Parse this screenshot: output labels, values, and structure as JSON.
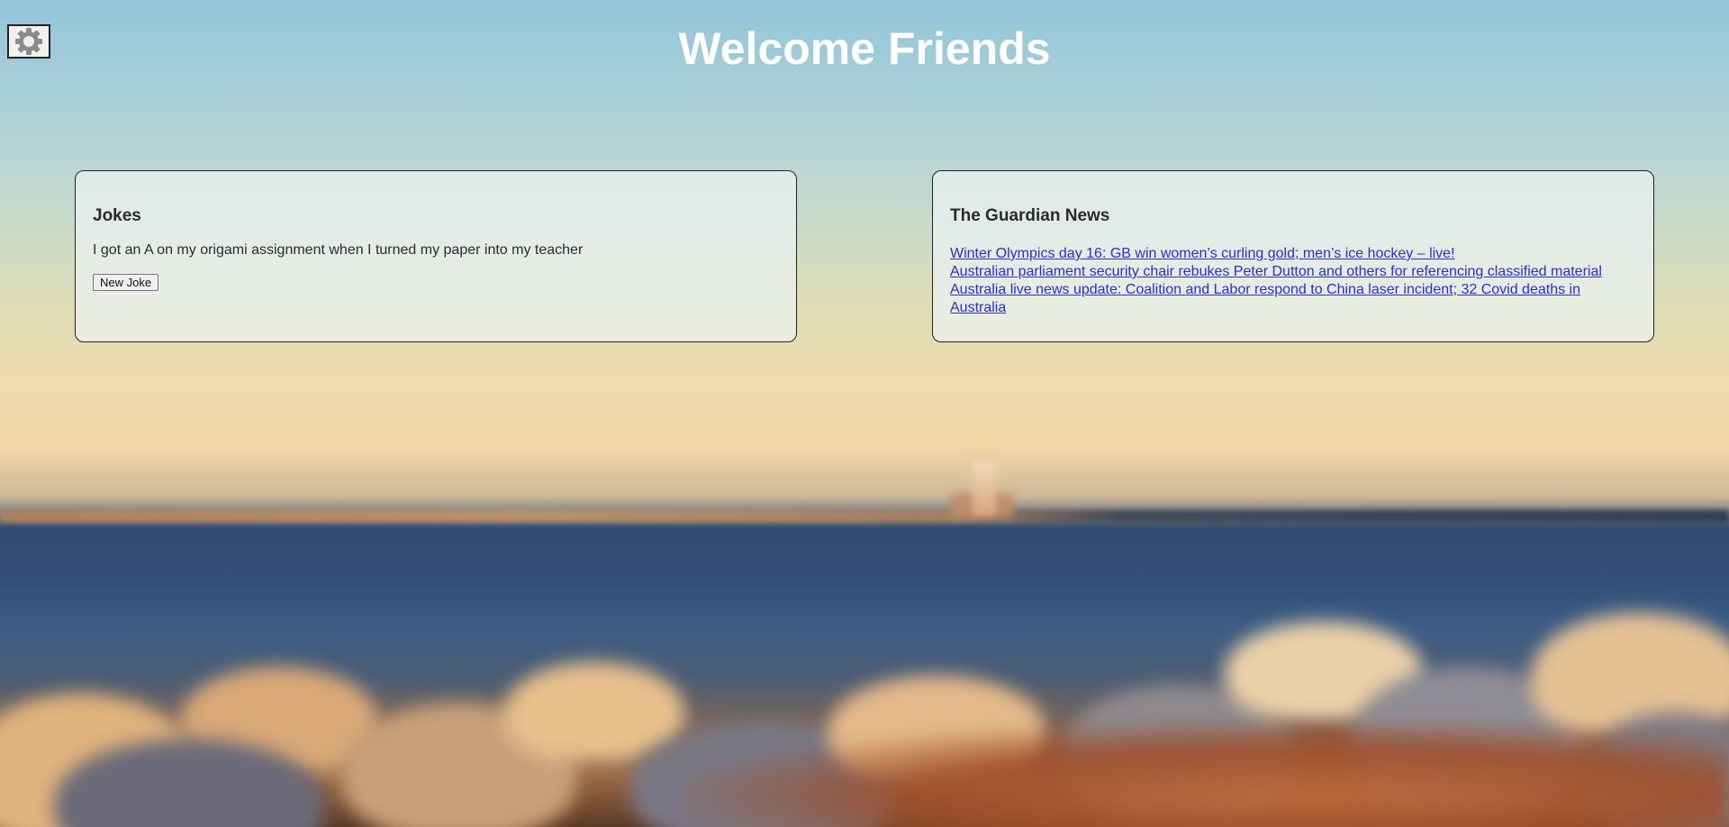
{
  "header": {
    "title": "Welcome Friends",
    "settings_icon": "gear-icon"
  },
  "jokes": {
    "heading": "Jokes",
    "text": "I got an A on my origami assignment when I turned my paper into my teacher",
    "button_label": "New Joke"
  },
  "news": {
    "heading": "The Guardian News",
    "items": [
      {
        "title": "Winter Olympics day 16: GB win women’s curling gold; men’s ice hockey – live!"
      },
      {
        "title": "Australian parliament security chair rebukes Peter Dutton and others for referencing classified material"
      },
      {
        "title": "Australia live news update: Coalition and Labor respond to China laser incident; 32 Covid deaths in Australia"
      }
    ]
  },
  "colors": {
    "link": "#2a2fc9",
    "title": "#ffffff",
    "card_border": "#222222"
  }
}
